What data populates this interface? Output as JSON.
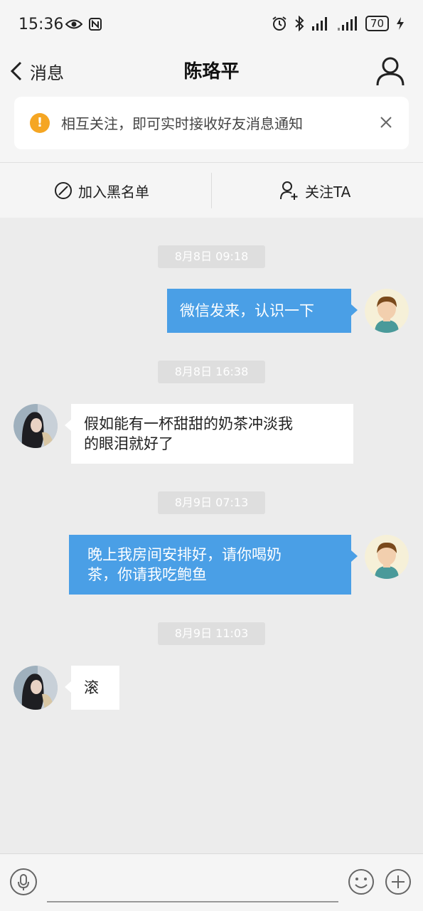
{
  "status_bar": {
    "time": "15:36",
    "battery": "70"
  },
  "header": {
    "back_label": "消息",
    "title": "陈珞平"
  },
  "notice": {
    "text": "相互关注，即可实时接收好友消息通知",
    "icon": "!"
  },
  "actions": {
    "block_label": "加入黑名单",
    "follow_label": "关注TA"
  },
  "messages": [
    {
      "timestamp": "8月8日 09:18",
      "direction": "outgoing",
      "lines": [
        "微信发来，认识一下"
      ]
    },
    {
      "timestamp": "8月8日 16:38",
      "direction": "incoming",
      "lines": [
        "假如能有一杯甜甜的奶茶冲淡我",
        "的眼泪就好了"
      ]
    },
    {
      "timestamp": "8月9日 07:13",
      "direction": "outgoing",
      "lines": [
        "晚上我房间安排好，请你喝奶",
        "茶，你请我吃鲍鱼"
      ]
    },
    {
      "timestamp": "8月9日 11:03",
      "direction": "incoming",
      "lines": [
        "滚"
      ]
    }
  ],
  "colors": {
    "outgoing_bubble": "#4a9fe6",
    "incoming_bubble": "#ffffff",
    "notice_icon": "#f5a623",
    "chat_background": "#ececec"
  }
}
